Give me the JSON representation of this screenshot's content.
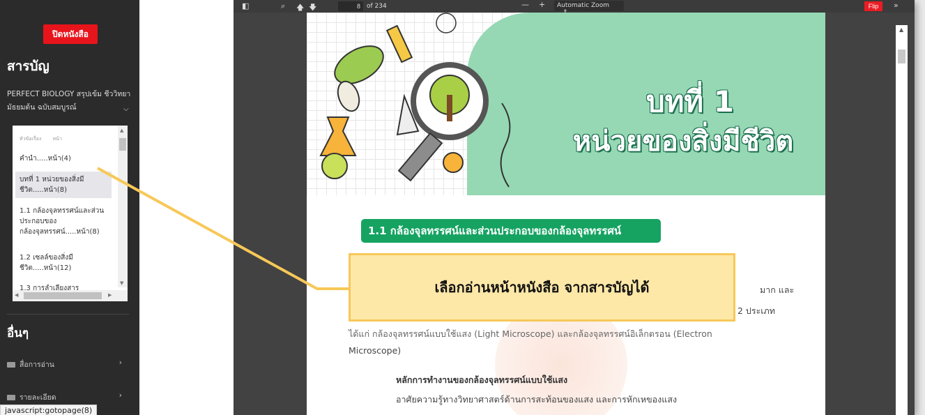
{
  "sidebar": {
    "close_label": "ปิดหนังสือ",
    "toc_title": "สารบัญ",
    "book_title": "PERFECT BIOLOGY สรุปเข้ม ชีววิทยา มัธยมต้น ฉบับสมบูรณ์",
    "toc_header": {
      "topic": "หัวข้อเรื่อง",
      "page": "หน้า"
    },
    "toc_items": [
      {
        "label": "คำนำ.....หน้า(4)"
      },
      {
        "label": "บทที่ 1 หน่วยของสิ่งมีชีวิต.....หน้า(8)"
      },
      {
        "label": "1.1 กล้องจุลทรรศน์และส่วนประกอบของกล้องจุลทรรศน์.....หน้า(8)"
      },
      {
        "label": "1.2 เซลล์ของสิ่งมีชีวิต.....หน้า(12)"
      },
      {
        "label": "1.3 การลำเลียงสาร"
      }
    ],
    "other_title": "อื่นๆ",
    "links": [
      {
        "label": "สื่อการอ่าน",
        "icon": "folder-icon"
      },
      {
        "label": "รายละเอียด",
        "icon": "folder-icon"
      }
    ]
  },
  "status_url": "javascript:gotopage(8)",
  "toolbar": {
    "page_number": "8",
    "page_total": "of 234",
    "zoom": "Automatic Zoom",
    "flip_label": "Flip",
    "more": "»"
  },
  "page": {
    "chapter_number": "บทที่ 1",
    "chapter_title": "หน่วยของสิ่งมีชีวิต",
    "section_title": "1.1 กล้องจุลทรรศน์และส่วนประกอบของกล้องจุลทรรศน์",
    "line1_right": "มาก และ",
    "line2_right": "2 ประเภท",
    "line3": "ได้แก่ กล้องจุลทรรศน์แบบใช้แสง (Light Microscope) และกล้องจุลทรรศน์อิเล็กตรอน (Electron",
    "line4": "Microscope)",
    "subheading": "หลักการทำงานของกล้องจุลทรรศน์แบบใช้แสง",
    "line5": "อาศัยความรู้ทางวิทยาศาสตร์ด้านการสะท้อนของแสง และการหักเหของแสง"
  },
  "callout": {
    "text": "เลือกอ่านหน้าหนังสือ จากสารบัญได้"
  },
  "colors": {
    "accent_red": "#e8141b",
    "banner_green": "#96d8b4",
    "section_green": "#16a362",
    "callout_fill": "#fde8a8",
    "callout_border": "#f7c858"
  }
}
